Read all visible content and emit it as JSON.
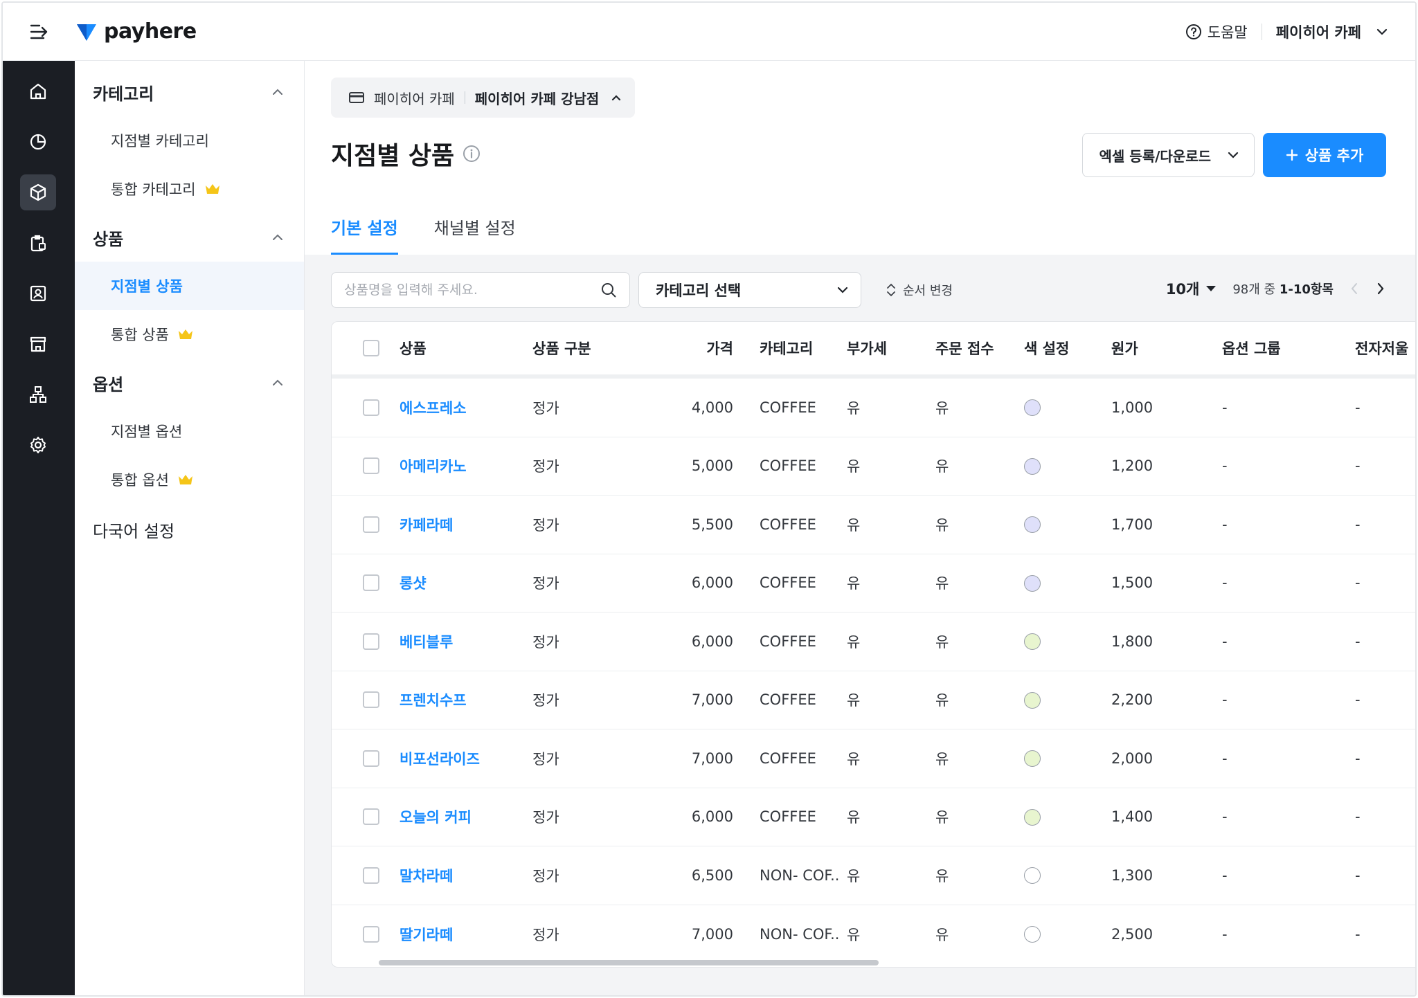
{
  "app": {
    "logo_text": "payhere"
  },
  "topbar": {
    "help_label": "도움말",
    "store_name": "페이히어 카페"
  },
  "rail": {
    "items": [
      {
        "icon": "home-icon",
        "active": false
      },
      {
        "icon": "pie-chart-icon",
        "active": false
      },
      {
        "icon": "box-icon",
        "active": true
      },
      {
        "icon": "clipboard-icon",
        "active": false
      },
      {
        "icon": "user-card-icon",
        "active": false
      },
      {
        "icon": "store-icon",
        "active": false
      },
      {
        "icon": "org-chart-icon",
        "active": false
      },
      {
        "icon": "gear-icon",
        "active": false
      }
    ]
  },
  "sidebar": {
    "category_group": "카테고리",
    "category_items": [
      "지점별 카테고리",
      "통합 카테고리"
    ],
    "product_group": "상품",
    "product_items": [
      "지점별 상품",
      "통합 상품"
    ],
    "option_group": "옵션",
    "option_items": [
      "지점별 옵션",
      "통합 옵션"
    ],
    "language": "다국어 설정"
  },
  "breadcrumb": {
    "brand": "페이히어 카페",
    "branch": "페이히어 카페 강남점"
  },
  "page": {
    "title": "지점별 상품",
    "excel_button": "엑셀 등록/다운로드",
    "add_button": "상품 추가"
  },
  "tabs": [
    "기본 설정",
    "채널별 설정"
  ],
  "toolbar": {
    "search_placeholder": "상품명을 입력해 주세요.",
    "category_select": "카테고리 선택",
    "order_change": "순서 변경",
    "page_size": "10개",
    "range_prefix": "98개 중 ",
    "range_value": "1-10항목"
  },
  "colors": {
    "accent": "#1a8cff",
    "rail_bg": "#1b1e24",
    "swatch_purple": "#dfe0fa",
    "swatch_green": "#e8f5cf",
    "swatch_white": "#ffffff"
  },
  "table": {
    "headers": {
      "product": "상품",
      "type": "상품 구분",
      "price": "가격",
      "category": "카테고리",
      "vat": "부가세",
      "order": "주문 접수",
      "color": "색 설정",
      "cost": "원가",
      "option_group": "옵션 그룹",
      "e_register": "전자저울"
    },
    "rows": [
      {
        "name": "에스프레소",
        "type": "정가",
        "price": "4,000",
        "category": "COFFEE",
        "vat": "유",
        "order": "유",
        "color": "#dfe0fa",
        "cost": "1,000",
        "option_group": "-",
        "e_register": "-"
      },
      {
        "name": "아메리카노",
        "type": "정가",
        "price": "5,000",
        "category": "COFFEE",
        "vat": "유",
        "order": "유",
        "color": "#dfe0fa",
        "cost": "1,200",
        "option_group": "-",
        "e_register": "-"
      },
      {
        "name": "카페라떼",
        "type": "정가",
        "price": "5,500",
        "category": "COFFEE",
        "vat": "유",
        "order": "유",
        "color": "#dfe0fa",
        "cost": "1,700",
        "option_group": "-",
        "e_register": "-"
      },
      {
        "name": "롱샷",
        "type": "정가",
        "price": "6,000",
        "category": "COFFEE",
        "vat": "유",
        "order": "유",
        "color": "#dfe0fa",
        "cost": "1,500",
        "option_group": "-",
        "e_register": "-"
      },
      {
        "name": "베티블루",
        "type": "정가",
        "price": "6,000",
        "category": "COFFEE",
        "vat": "유",
        "order": "유",
        "color": "#e8f5cf",
        "cost": "1,800",
        "option_group": "-",
        "e_register": "-"
      },
      {
        "name": "프렌치수프",
        "type": "정가",
        "price": "7,000",
        "category": "COFFEE",
        "vat": "유",
        "order": "유",
        "color": "#e8f5cf",
        "cost": "2,200",
        "option_group": "-",
        "e_register": "-"
      },
      {
        "name": "비포선라이즈",
        "type": "정가",
        "price": "7,000",
        "category": "COFFEE",
        "vat": "유",
        "order": "유",
        "color": "#e8f5cf",
        "cost": "2,000",
        "option_group": "-",
        "e_register": "-"
      },
      {
        "name": "오늘의 커피",
        "type": "정가",
        "price": "6,000",
        "category": "COFFEE",
        "vat": "유",
        "order": "유",
        "color": "#e8f5cf",
        "cost": "1,400",
        "option_group": "-",
        "e_register": "-"
      },
      {
        "name": "말차라떼",
        "type": "정가",
        "price": "6,500",
        "category": "NON- COF..",
        "vat": "유",
        "order": "유",
        "color": "#ffffff",
        "cost": "1,300",
        "option_group": "-",
        "e_register": "-"
      },
      {
        "name": "딸기라떼",
        "type": "정가",
        "price": "7,000",
        "category": "NON- COF..",
        "vat": "유",
        "order": "유",
        "color": "#ffffff",
        "cost": "2,500",
        "option_group": "-",
        "e_register": "-"
      }
    ]
  }
}
